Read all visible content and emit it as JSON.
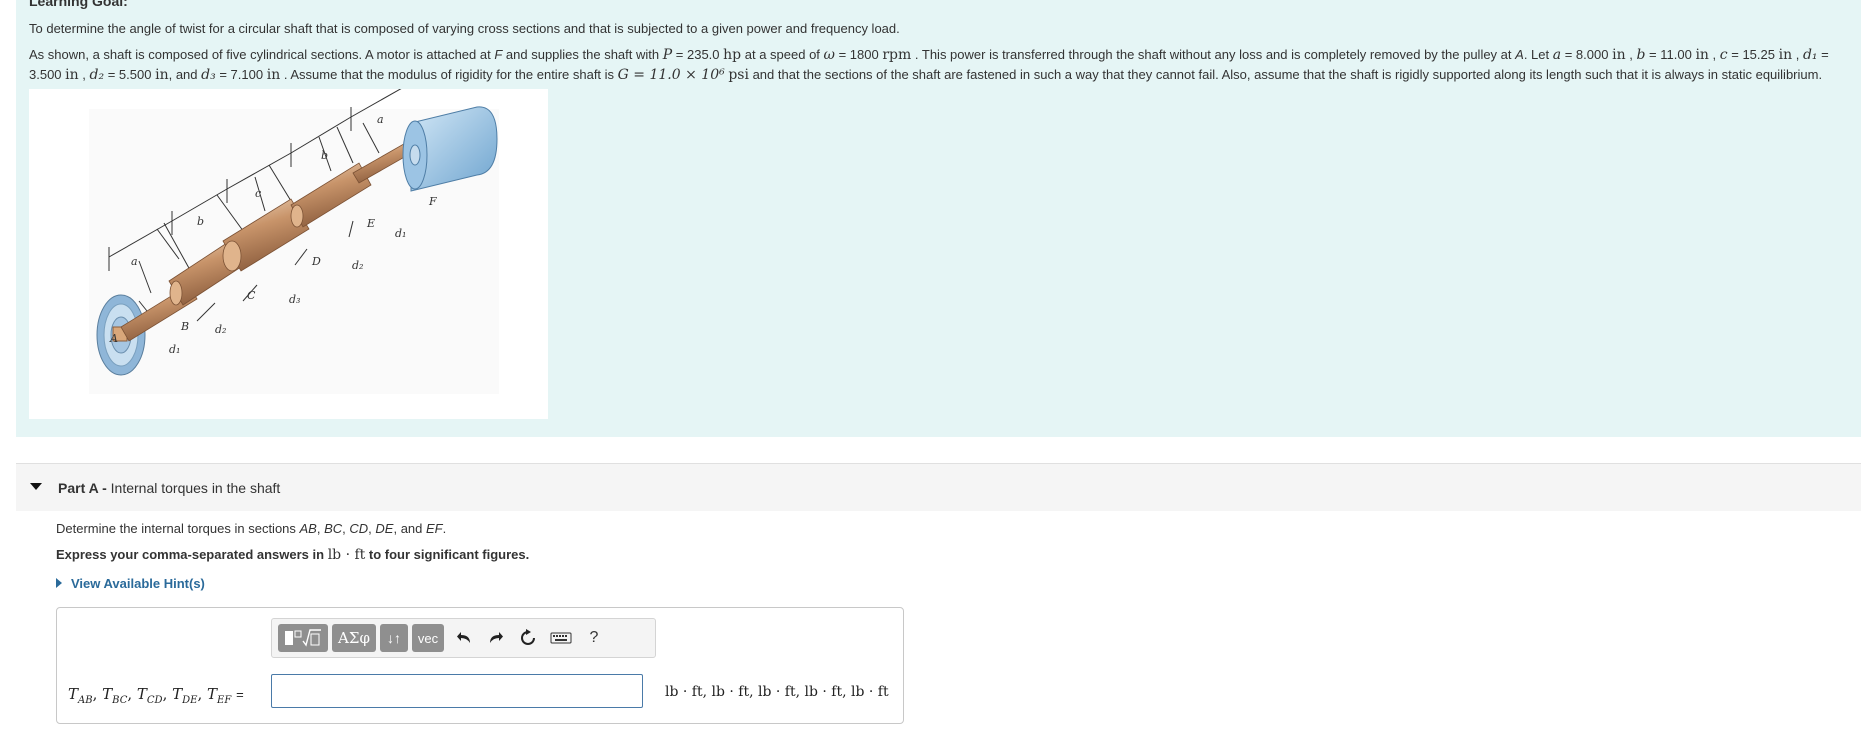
{
  "learning_goal": {
    "heading": "Learning Goal:",
    "intro": "To determine the angle of twist for a circular shaft that is composed of varying cross sections and that is subjected to a given power and frequency load."
  },
  "problem": {
    "s1": "As shown, a shaft is composed of five cylindrical sections. A motor is attached at ",
    "F1": "F",
    "s2": " and supplies the shaft with ",
    "P_sym": "P",
    "P_val": "= 235.0",
    "P_unit": "hp",
    "s3": " at a speed of ",
    "w_sym": "ω",
    "w_val": "= 1800",
    "w_unit": "rpm",
    "s4": " . This power is transferred through the shaft without any loss and is completely removed by the pulley at ",
    "A1": "A",
    "s5": ". Let ",
    "a_sym": "a",
    "a_val": "= 8.000",
    "a_unit": "in",
    "b_sym": "b",
    "b_val": "= 11.00",
    "b_unit": "in",
    "c_sym": "c",
    "c_val": "= 15.25",
    "c_unit": "in",
    "d1_sym": "d₁",
    "d1_val": "= 3.500",
    "d1_unit": "in",
    "d2_sym": "d₂",
    "d2_val": "= 5.500",
    "d2_unit": "in",
    "and_word": ", and",
    "d3_sym": "d₃",
    "d3_val": "= 7.100",
    "d3_unit": "in",
    "s6": " . Assume that the modulus of rigidity for the entire shaft is ",
    "G_expr": "G = 11.0 × 10⁶",
    "G_unit": "psi",
    "s7": " and that the sections of the shaft are fastened in such a way that they cannot fail. Also, assume that the shaft is rigidly supported along its length such that it is always in static equilibrium."
  },
  "figure": {
    "labels": {
      "a": "a",
      "b": "b",
      "c": "c",
      "A": "A",
      "B": "B",
      "C": "C",
      "D": "D",
      "E": "E",
      "F": "F",
      "d1": "d₁",
      "d2": "d₂",
      "d3": "d₃"
    }
  },
  "part_a": {
    "part_label": "Part A -",
    "title": "Internal torques in the shaft",
    "question_prefix": "Determine the internal torques in sections ",
    "sections": [
      "AB",
      "BC",
      "CD",
      "DE",
      "EF"
    ],
    "sep_comma": ", ",
    "sep_and": ", and ",
    "period": ".",
    "instruction_pre": "Express your comma-separated answers in ",
    "instruction_unit": "lb · ft",
    "instruction_post": " to four significant figures.",
    "hint_link": "View Available Hint(s)",
    "answer_label": "T_AB, T_BC, T_CD, T_DE, T_EF =",
    "answer_value": "",
    "units": "lb · ft, lb · ft, lb · ft, lb · ft, lb · ft",
    "toolbar": {
      "templates_icon": "templates-icon",
      "greek_label": "ΑΣφ",
      "arrows_label": "↓↑",
      "vec_label": "vec",
      "undo_icon": "undo-icon",
      "redo_icon": "redo-icon",
      "reset_icon": "reset-icon",
      "keyboard_icon": "keyboard-icon",
      "help_label": "?"
    }
  },
  "colors": {
    "goal_background": "#e5f5f5",
    "link": "#2a6a9a",
    "toolbar_button": "#8f8f8f",
    "input_border": "#4a7aa8",
    "shaft": "#c8946a",
    "motor": "#8fbde0",
    "pulley": "#a8c8e0"
  }
}
